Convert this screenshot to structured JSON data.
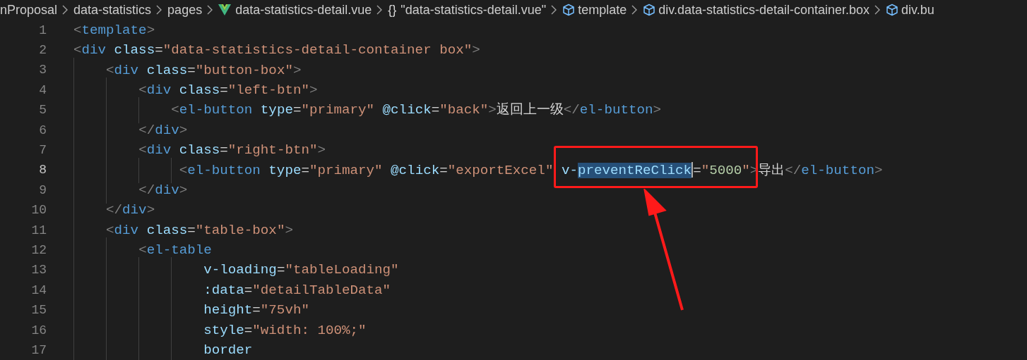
{
  "breadcrumb": [
    {
      "kind": "folder",
      "text": "nProposal"
    },
    {
      "kind": "folder",
      "text": "data-statistics"
    },
    {
      "kind": "folder",
      "text": "pages"
    },
    {
      "kind": "vue",
      "text": "data-statistics-detail.vue"
    },
    {
      "kind": "braces",
      "glyph": "{}",
      "text": "\"data-statistics-detail.vue\""
    },
    {
      "kind": "element",
      "text": "template"
    },
    {
      "kind": "element",
      "text": "div.data-statistics-detail-container.box"
    },
    {
      "kind": "element",
      "text": "div.bu"
    }
  ],
  "lines": [
    {
      "number": "1",
      "active": false,
      "code": "<template>"
    },
    {
      "number": "2",
      "active": false,
      "code": "<div class=\"data-statistics-detail-container box\">"
    },
    {
      "number": "3",
      "active": false,
      "code": "    <div class=\"button-box\">"
    },
    {
      "number": "4",
      "active": false,
      "code": "        <div class=\"left-btn\">"
    },
    {
      "number": "5",
      "active": false,
      "code": "            <el-button type=\"primary\" @click=\"back\">返回上一级</el-button>"
    },
    {
      "number": "6",
      "active": false,
      "code": "        </div>"
    },
    {
      "number": "7",
      "active": false,
      "code": "        <div class=\"right-btn\">"
    },
    {
      "number": "8",
      "active": true,
      "code": "             <el-button type=\"primary\" @click=\"exportExcel\" v-",
      "selection": "preventReClick",
      "after": "=\"5000\">导出</el-button>"
    },
    {
      "number": "9",
      "active": false,
      "code": "        </div>"
    },
    {
      "number": "10",
      "active": false,
      "code": "    </div>"
    },
    {
      "number": "11",
      "active": false,
      "code": "    <div class=\"table-box\">"
    },
    {
      "number": "12",
      "active": false,
      "code": "        <el-table"
    },
    {
      "number": "13",
      "active": false,
      "code": "                v-loading=\"tableLoading\""
    },
    {
      "number": "14",
      "active": false,
      "code": "                :data=\"detailTableData\""
    },
    {
      "number": "15",
      "active": false,
      "code": "                height=\"75vh\""
    },
    {
      "number": "16",
      "active": false,
      "code": "                style=\"width: 100%;\""
    },
    {
      "number": "17",
      "active": false,
      "code": "                border"
    }
  ]
}
